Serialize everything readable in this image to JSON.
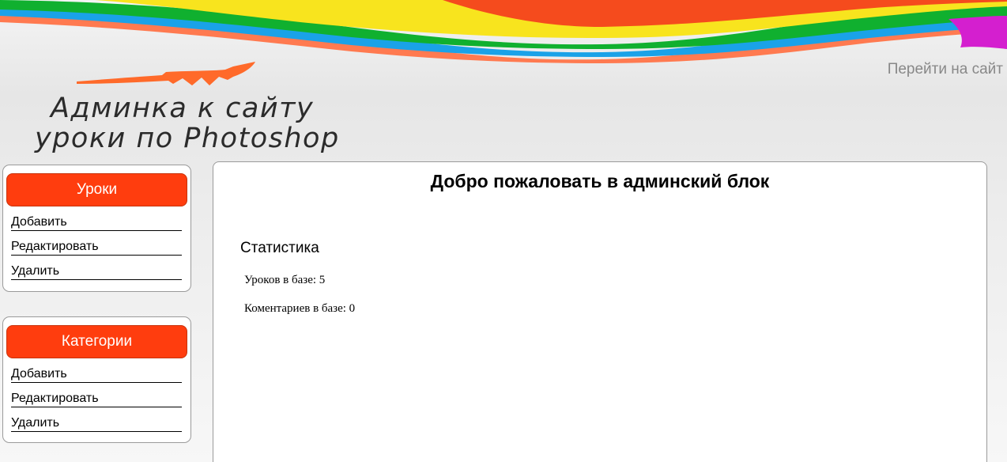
{
  "header": {
    "goto_site": "Перейти на сайт",
    "logo_line1": "Админка к сайту",
    "logo_line2": "уроки по Photoshop",
    "rainbow_colors": [
      "#ff7a50",
      "#1aa2e8",
      "#10b02f",
      "#f8e41e",
      "#f54b1d",
      "#d41fcf"
    ]
  },
  "sidebar": {
    "lessons": {
      "title": "Уроки",
      "items": [
        "Добавить",
        "Редактировать",
        "Удалить"
      ]
    },
    "categories": {
      "title": "Категории",
      "items": [
        "Добавить",
        "Редактировать",
        "Удалить"
      ]
    },
    "accent_color": "#ff3d0e"
  },
  "main": {
    "title": "Добро пожаловать в админский блок",
    "stats_title": "Статистика",
    "stats": [
      "Уроков в базе: 5",
      "Коментариев в базе: 0"
    ]
  }
}
